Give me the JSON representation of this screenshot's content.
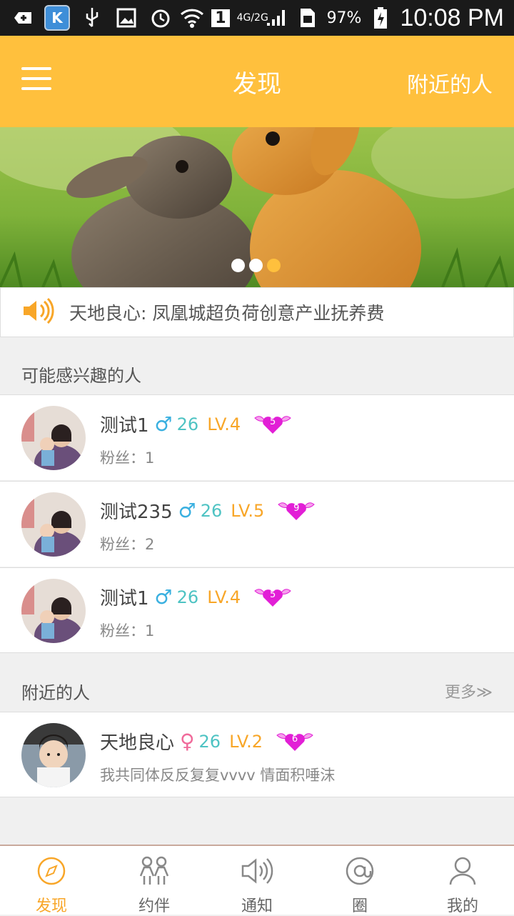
{
  "status_bar": {
    "battery": "97%",
    "time": "10:08 PM",
    "sim": "1",
    "network": "4G/2G",
    "k_app": "K"
  },
  "title_bar": {
    "title": "发现",
    "right_link": "附近的人"
  },
  "banner": {
    "slides_total": 3,
    "active_slide": 3
  },
  "notice": {
    "text": "天地良心: 凤凰城超负荷创意产业抚养费"
  },
  "interested": {
    "header": "可能感兴趣的人",
    "items": [
      {
        "name": "测试1",
        "gender": "♂",
        "age": "26",
        "level": "LV.4",
        "heart": "5",
        "sub": "粉丝：1"
      },
      {
        "name": "测试235",
        "gender": "♂",
        "age": "26",
        "level": "LV.5",
        "heart": "9",
        "sub": "粉丝：2"
      },
      {
        "name": "测试1",
        "gender": "♂",
        "age": "26",
        "level": "LV.4",
        "heart": "5",
        "sub": "粉丝：1"
      }
    ]
  },
  "nearby": {
    "header": "附近的人",
    "more": "更多≫",
    "items": [
      {
        "name": "天地良心",
        "gender": "♀",
        "age": "26",
        "level": "LV.2",
        "heart": "6",
        "sub": "我共同体反反复复vvvv 情面积唾沫"
      }
    ]
  },
  "tabs": [
    {
      "label": "发现",
      "icon": "compass-icon",
      "active": true
    },
    {
      "label": "约伴",
      "icon": "companions-icon",
      "active": false
    },
    {
      "label": "通知",
      "icon": "speaker-icon",
      "active": false
    },
    {
      "label": "圈",
      "icon": "at-icon",
      "active": false
    },
    {
      "label": "我的",
      "icon": "person-icon",
      "active": false
    }
  ],
  "colors": {
    "accent": "#ffc03d",
    "level": "#f8a628",
    "heart": "#e21fd6",
    "male": "#3ab0e0",
    "female": "#f06a9a"
  }
}
